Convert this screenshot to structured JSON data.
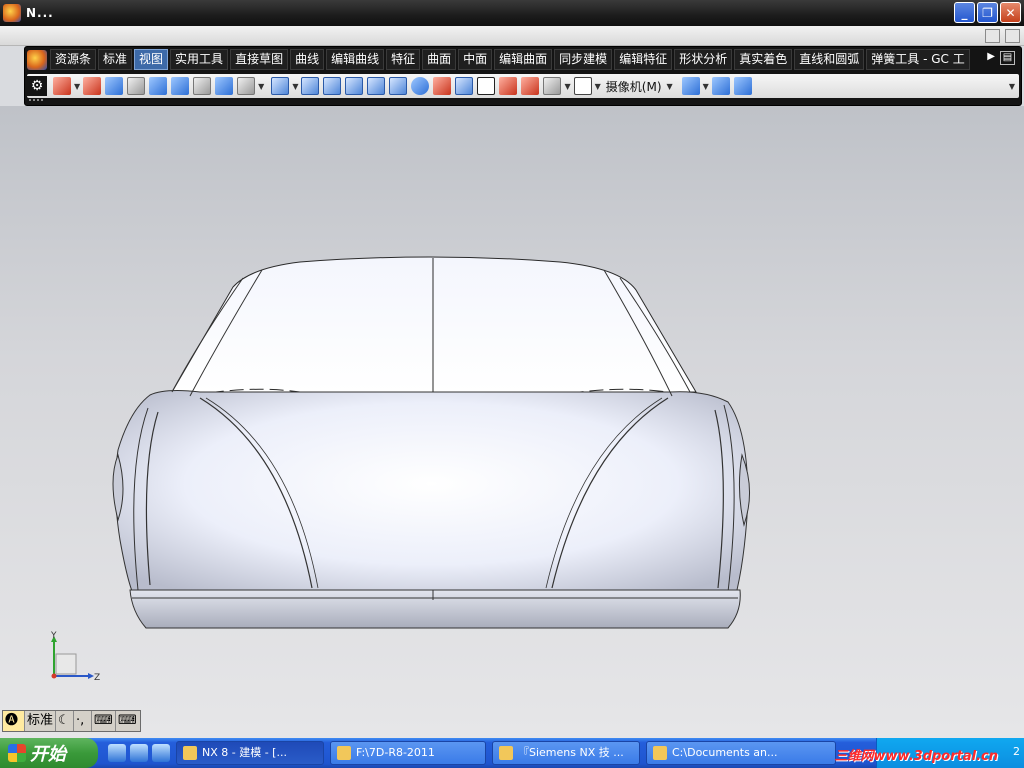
{
  "window": {
    "title": "N...",
    "min_label": "_",
    "max_label": "❐",
    "close_label": "✕"
  },
  "ribbon": {
    "tabs": [
      {
        "label": "资源条"
      },
      {
        "label": "标准"
      },
      {
        "label": "视图",
        "active": true
      },
      {
        "label": "实用工具"
      },
      {
        "label": "直接草图"
      },
      {
        "label": "曲线"
      },
      {
        "label": "编辑曲线"
      },
      {
        "label": "特征"
      },
      {
        "label": "曲面"
      },
      {
        "label": "中面"
      },
      {
        "label": "编辑曲面"
      },
      {
        "label": "同步建模"
      },
      {
        "label": "编辑特征"
      },
      {
        "label": "形状分析"
      },
      {
        "label": "真实着色"
      },
      {
        "label": "直线和圆弧"
      },
      {
        "label": "弹簧工具 - GC 工"
      }
    ],
    "tab_overflow": "▶",
    "camera_label": "摄像机(M)"
  },
  "viewport": {
    "axis_labels": {
      "y": "Y",
      "z": "Z"
    }
  },
  "ime": {
    "mode_label": "标准"
  },
  "taskbar": {
    "start_label": "开始",
    "tasks": [
      {
        "label": "NX 8 - 建模 - [...",
        "active": true
      },
      {
        "label": "F:\\7D-R8-2011"
      },
      {
        "label": "『Siemens NX 技 ..."
      },
      {
        "label": "C:\\Documents an..."
      }
    ],
    "watermark": "三维网www.3dportal.cn",
    "clock": "2"
  }
}
